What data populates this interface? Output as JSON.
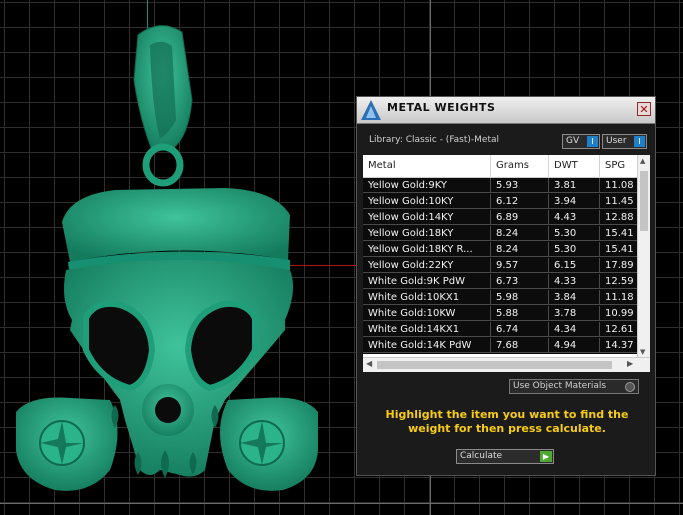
{
  "panel": {
    "title": "METAL WEIGHTS",
    "close_glyph": "✕",
    "library_label": "Library: Classic - (Fast)-Metal",
    "gv_toggle": {
      "label": "GV",
      "state": "I"
    },
    "user_toggle": {
      "label": "User",
      "state": "I"
    }
  },
  "table": {
    "columns": [
      "Metal",
      "Grams",
      "DWT",
      "SPG"
    ],
    "rows": [
      {
        "metal": "Yellow Gold:9KY",
        "grams": "5.93",
        "dwt": "3.81",
        "spg": "11.08"
      },
      {
        "metal": "Yellow Gold:10KY",
        "grams": "6.12",
        "dwt": "3.94",
        "spg": "11.45"
      },
      {
        "metal": "Yellow Gold:14KY",
        "grams": "6.89",
        "dwt": "4.43",
        "spg": "12.88"
      },
      {
        "metal": "Yellow Gold:18KY",
        "grams": "8.24",
        "dwt": "5.30",
        "spg": "15.41"
      },
      {
        "metal": "Yellow Gold:18KY R...",
        "grams": "8.24",
        "dwt": "5.30",
        "spg": "15.41"
      },
      {
        "metal": "Yellow Gold:22KY",
        "grams": "9.57",
        "dwt": "6.15",
        "spg": "17.89"
      },
      {
        "metal": "White Gold:9K PdW",
        "grams": "6.73",
        "dwt": "4.33",
        "spg": "12.59"
      },
      {
        "metal": "White Gold:10KX1",
        "grams": "5.98",
        "dwt": "3.84",
        "spg": "11.18"
      },
      {
        "metal": "White Gold:10KW",
        "grams": "5.88",
        "dwt": "3.78",
        "spg": "10.99"
      },
      {
        "metal": "White Gold:14KX1",
        "grams": "6.74",
        "dwt": "4.34",
        "spg": "12.61"
      },
      {
        "metal": "White Gold:14K PdW",
        "grams": "7.68",
        "dwt": "4.94",
        "spg": "14.37"
      }
    ]
  },
  "use_object_materials": {
    "label": "Use Object Materials"
  },
  "instruction": "Highlight the item you want to find the weight for then press calculate.",
  "calculate_button": {
    "label": "Calculate",
    "go_glyph": "▶"
  },
  "colors": {
    "model": "#1f9e7a",
    "instruction_text": "#f7cc13",
    "toggle_blue": "#1f7fc9",
    "calculate_green": "#4caa2e"
  },
  "icons": [
    "app-logo-icon",
    "close-icon",
    "play-icon"
  ]
}
